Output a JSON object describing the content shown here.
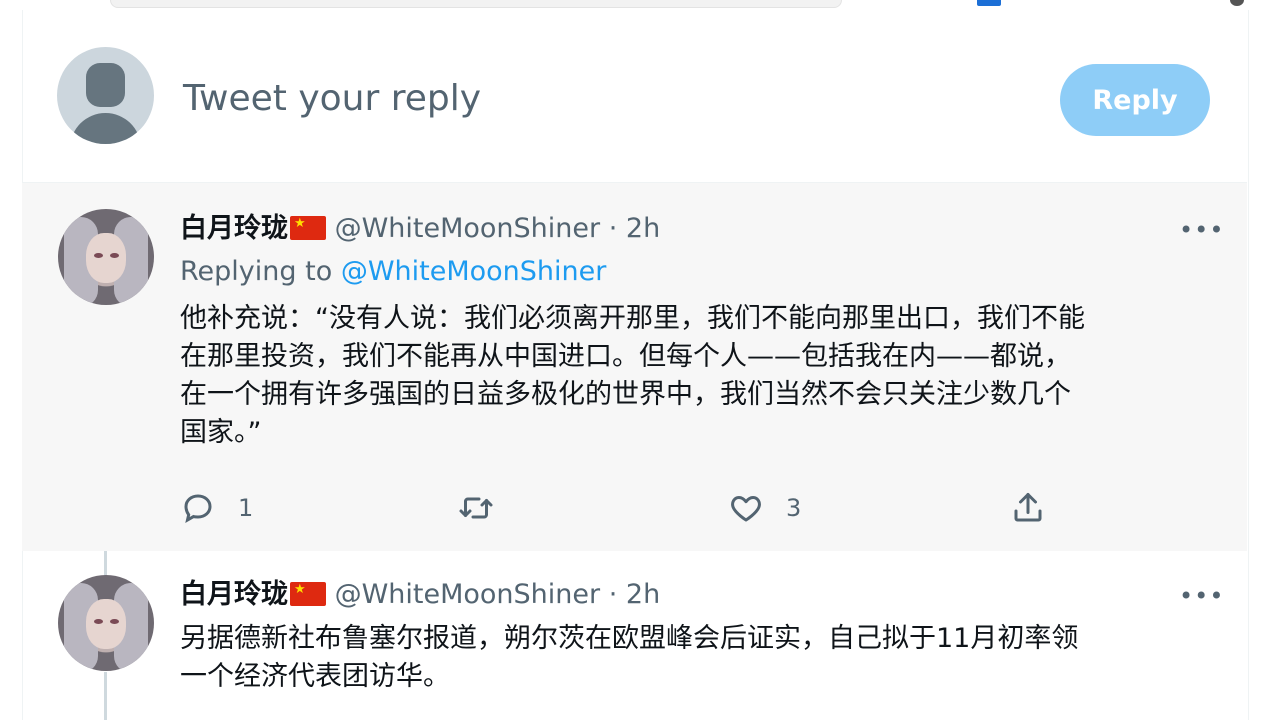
{
  "compose": {
    "placeholder": "Tweet your reply",
    "reply_label": "Reply"
  },
  "tweets": [
    {
      "display_name": "白月玲珑",
      "handle": "@WhiteMoonShiner",
      "separator": "·",
      "time": "2h",
      "replying_prefix": "Replying to",
      "replying_to": "@WhiteMoonShiner",
      "text_lines": [
        "他补充说：“没有人说：我们必须离开那里，我们不能向那里出口，我们不能",
        "在那里投资，我们不能再从中国进口。但每个人——包括我在内——都说，",
        "在一个拥有许多强国的日益多极化的世界中，我们当然不会只关注少数几个",
        "国家。”"
      ],
      "reply_count": "1",
      "like_count": "3"
    },
    {
      "display_name": "白月玲珑",
      "handle": "@WhiteMoonShiner",
      "separator": "·",
      "time": "2h",
      "text_lines": [
        "另据德新社布鲁塞尔报道，朔尔茨在欧盟峰会后证实，自己拟于11月初率领",
        "一个经济代表团访华。"
      ]
    }
  ],
  "colors": {
    "accent": "#1d9bf0",
    "reply_button": "#8ecdf7",
    "muted": "#536471",
    "flag_red": "#de2910",
    "flag_star": "#ffde00"
  },
  "icons": [
    "reply-icon",
    "retweet-icon",
    "like-icon",
    "share-icon",
    "more-icon",
    "default-avatar-icon",
    "china-flag-icon"
  ]
}
